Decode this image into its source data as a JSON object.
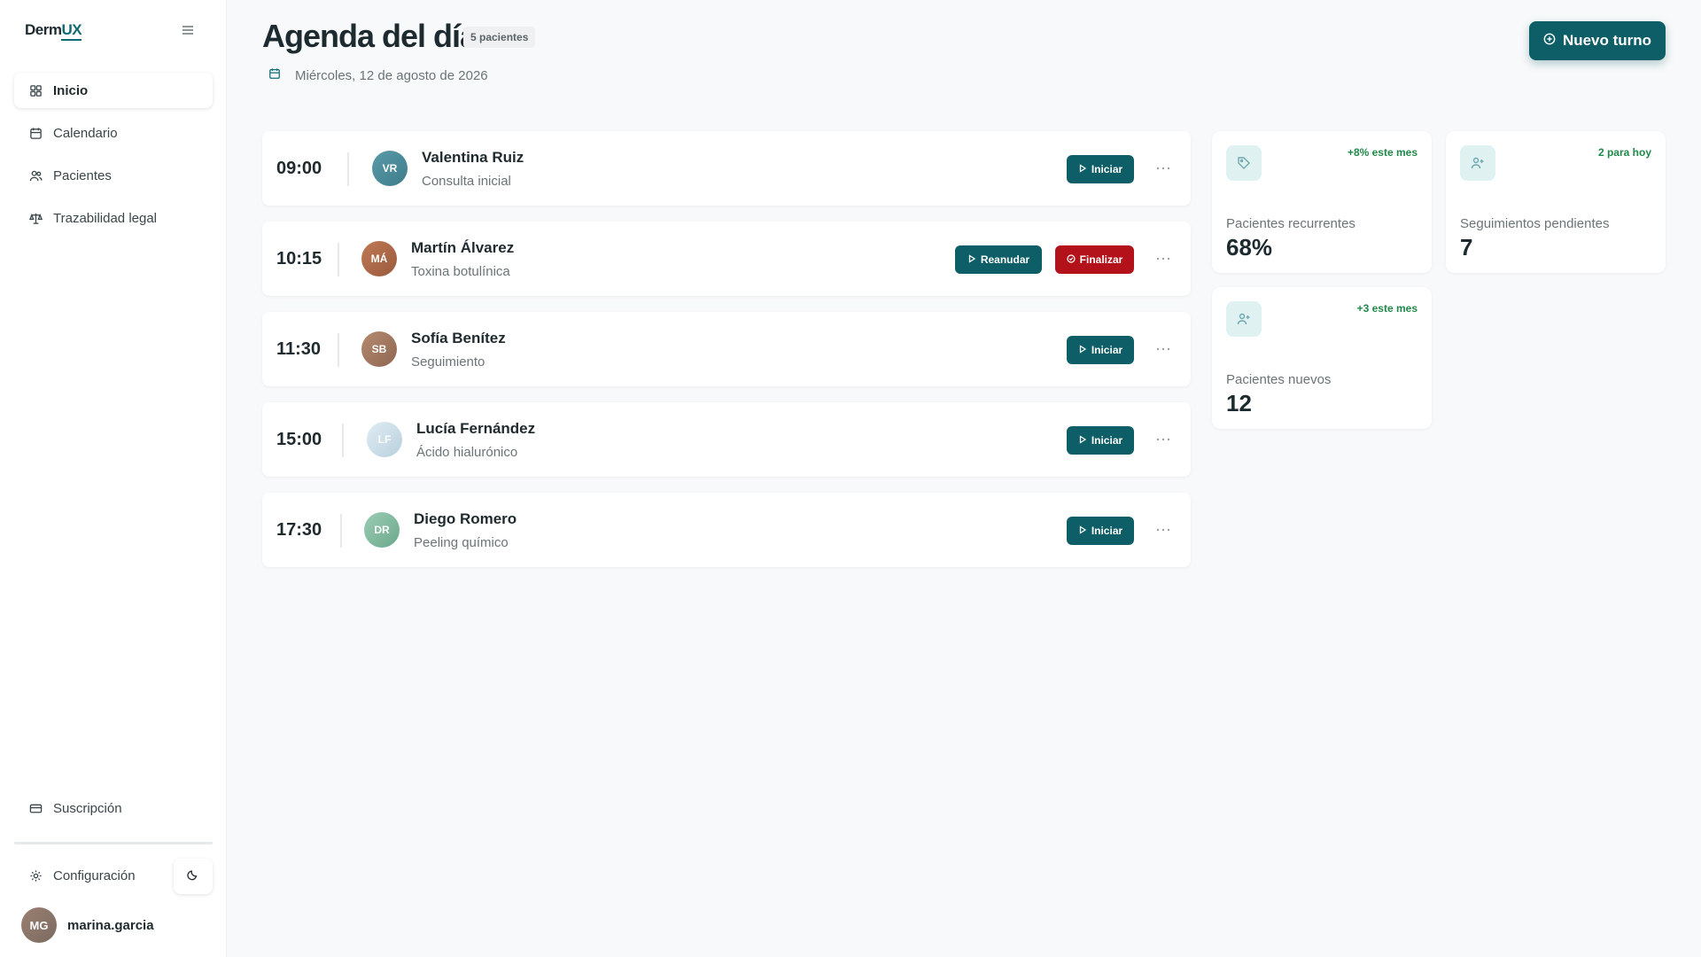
{
  "app": {
    "logo_prefix": "Derm",
    "logo_suffix": "UX"
  },
  "sidebar": {
    "items": [
      {
        "label": "Inicio",
        "icon": "grid-icon",
        "active": true
      },
      {
        "label": "Calendario",
        "icon": "calendar-icon"
      },
      {
        "label": "Pacientes",
        "icon": "users-icon"
      },
      {
        "label": "Trazabilidad legal",
        "icon": "scale-icon"
      }
    ],
    "subscription_label": "Suscripción",
    "settings_label": "Configuración",
    "user": {
      "initials": "MG",
      "name": "marina.garcia"
    }
  },
  "header": {
    "title": "Agenda del día",
    "count_badge": "5 pacientes",
    "date": "Miércoles, 12 de agosto de 2026",
    "new_button": "Nuevo turno"
  },
  "appointments": [
    {
      "time": "09:00",
      "initials": "VR",
      "name": "Valentina Ruiz",
      "procedure": "Consulta inicial",
      "avatar_color": "#4e8e9c",
      "actions": [
        "Iniciar"
      ]
    },
    {
      "time": "10:15",
      "initials": "MÁ",
      "name": "Martín Álvarez",
      "procedure": "Toxina botulínica",
      "avatar_color": "#b0674a",
      "actions": [
        "Reanudar",
        "Finalizar"
      ]
    },
    {
      "time": "11:30",
      "initials": "SB",
      "name": "Sofía Benítez",
      "procedure": "Seguimiento",
      "avatar_color": "#a87a60",
      "actions": [
        "Iniciar"
      ]
    },
    {
      "time": "15:00",
      "initials": "LF",
      "name": "Lucía Fernández",
      "procedure": "Ácido hialurónico",
      "avatar_color": "#c9dde8",
      "actions": [
        "Iniciar"
      ]
    },
    {
      "time": "17:30",
      "initials": "DR",
      "name": "Diego Romero",
      "procedure": "Peeling químico",
      "avatar_color": "#7fb8a0",
      "actions": [
        "Iniciar"
      ]
    }
  ],
  "stats": [
    {
      "label": "Pacientes recurrentes",
      "value": "68%",
      "trend": "+8% este mes",
      "icon": "tag-icon"
    },
    {
      "label": "Seguimientos pendientes",
      "value": "7",
      "trend": "2 para hoy",
      "icon": "user-plus-icon"
    },
    {
      "label": "Pacientes nuevos",
      "value": "12",
      "trend": "+3 este mes",
      "icon": "user-plus-icon"
    }
  ],
  "colors": {
    "accent": "#0d5e66",
    "danger": "#b3121b",
    "trend": "#1e8a4a"
  }
}
